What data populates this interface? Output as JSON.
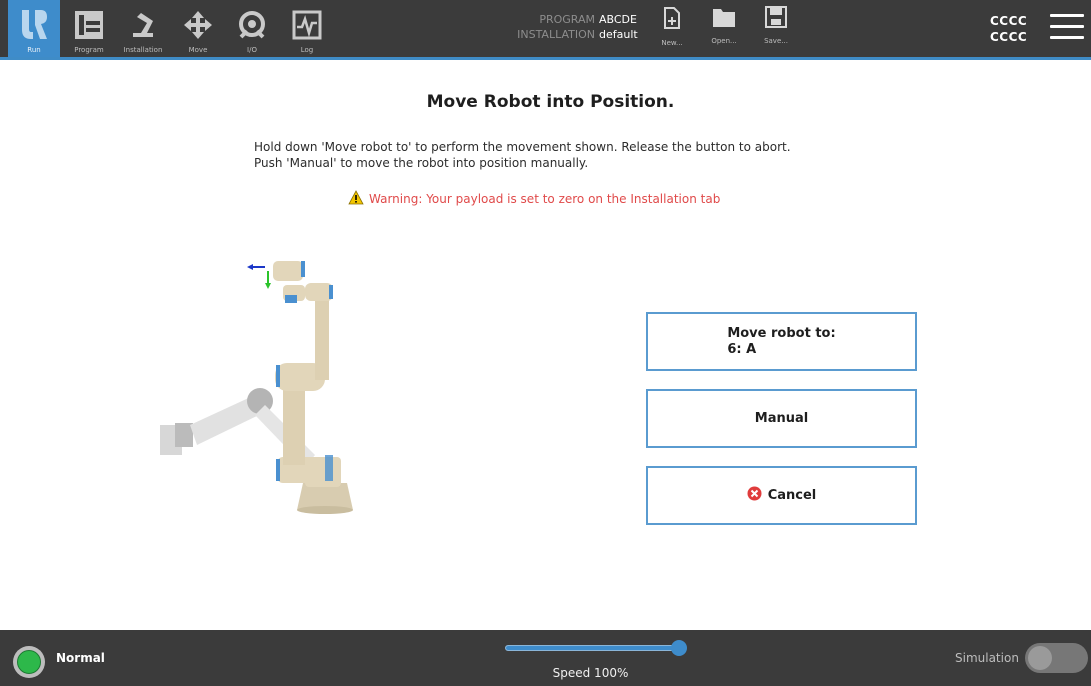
{
  "topbar": {
    "nav": [
      {
        "id": "run",
        "label": "Run",
        "icon": "ur-logo-icon"
      },
      {
        "id": "program",
        "label": "Program",
        "icon": "program-icon"
      },
      {
        "id": "installation",
        "label": "Installation",
        "icon": "installation-icon"
      },
      {
        "id": "move",
        "label": "Move",
        "icon": "move-arrows-icon"
      },
      {
        "id": "io",
        "label": "I/O",
        "icon": "io-icon"
      },
      {
        "id": "log",
        "label": "Log",
        "icon": "log-icon"
      }
    ],
    "program_label": "PROGRAM",
    "program_value": "ABCDE",
    "installation_label": "INSTALLATION",
    "installation_value": "default",
    "file": [
      {
        "id": "new",
        "label": "New...",
        "icon": "new-file-icon"
      },
      {
        "id": "open",
        "label": "Open...",
        "icon": "folder-icon"
      },
      {
        "id": "save",
        "label": "Save...",
        "icon": "save-icon"
      }
    ],
    "right_line1": "CCCC",
    "right_line2": "CCCC"
  },
  "main": {
    "title": "Move Robot into Position.",
    "instruction_line1": "Hold down 'Move robot to' to perform the movement shown. Release the button to abort.",
    "instruction_line2": "Push 'Manual' to move the robot into position manually.",
    "warning": "Warning: Your payload is set to zero on the Installation tab",
    "move_button_line1": "Move robot to:",
    "move_button_line2": "6: A",
    "manual_button": "Manual",
    "cancel_button": "Cancel"
  },
  "bottombar": {
    "status": "Normal",
    "speed_text": "Speed 100%",
    "speed_fraction": 1.0,
    "simulation_label": "Simulation",
    "simulation_on": false
  },
  "colors": {
    "accent": "#3e8ccb",
    "warning": "#e04a4a",
    "status_ok": "#2db84a",
    "bar_bg": "#3b3b3b"
  }
}
